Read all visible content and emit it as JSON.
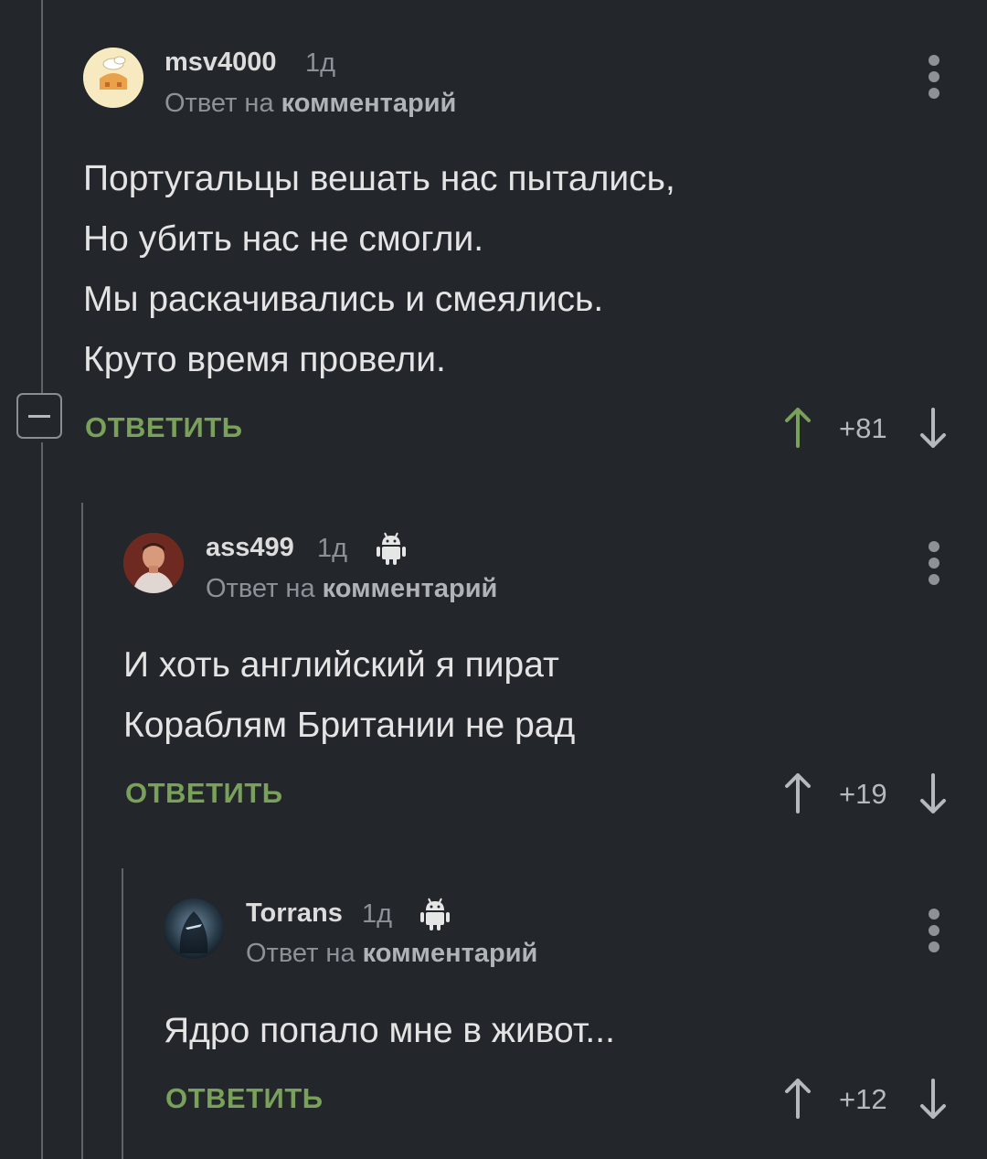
{
  "comments": [
    {
      "username": "msv4000",
      "time": "1д",
      "reply_prefix": "Ответ на",
      "reply_target": "комментарий",
      "lines": [
        "Португальцы вешать нас пытались,",
        "Но убить нас не смогли.",
        "Мы раскачивались и смеялись.",
        "Круто время провели."
      ],
      "reply_label": "ОТВЕТИТЬ",
      "rating": "+81",
      "android": false,
      "up_color": "#79a15a"
    },
    {
      "username": "ass499",
      "time": "1д",
      "reply_prefix": "Ответ на",
      "reply_target": "комментарий",
      "lines": [
        "И хоть английский я пират",
        "Кораблям Британии не рад"
      ],
      "reply_label": "ОТВЕТИТЬ",
      "rating": "+19",
      "android": true,
      "up_color": "#b5b8bd"
    },
    {
      "username": "Torrans",
      "time": "1д",
      "reply_prefix": "Ответ на",
      "reply_target": "комментарий",
      "lines": [
        "Ядро попало мне в живот..."
      ],
      "reply_label": "ОТВЕТИТЬ",
      "rating": "+12",
      "android": true,
      "up_color": "#b5b8bd"
    }
  ],
  "colors": {
    "background": "#23262b",
    "accent_green": "#79a15a",
    "muted_text": "#8e9298"
  }
}
